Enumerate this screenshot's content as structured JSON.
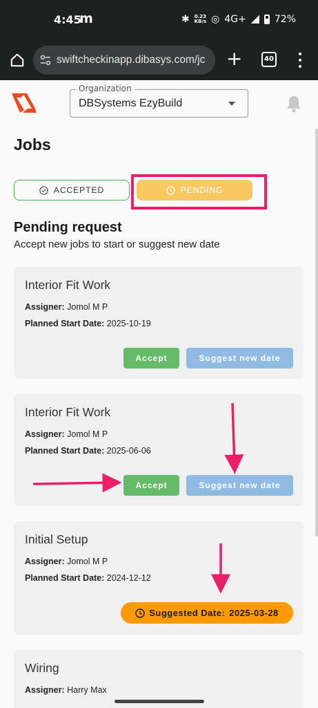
{
  "status": {
    "time": "4:45",
    "app_glyph": "m",
    "speed_value": "0.23",
    "speed_unit": "KB/s",
    "network": "4G+",
    "battery": "72%"
  },
  "browser": {
    "url": "swiftcheckinapp.dibasys.com/jc",
    "tab_count": "40"
  },
  "header": {
    "org_label": "Organization",
    "org_value": "DBSystems EzyBuild"
  },
  "page": {
    "title": "Jobs",
    "tabs": [
      {
        "label": "ACCEPTED"
      },
      {
        "label": "PENDING"
      }
    ],
    "section_title": "Pending request",
    "section_subtitle": "Accept new jobs to start or suggest new date"
  },
  "labels": {
    "assigner": "Assigner:",
    "planned": "Planned Start Date:",
    "accept": "Accept",
    "suggest": "Suggest new date",
    "suggested_prefix": "Suggested Date:"
  },
  "jobs": [
    {
      "title": "Interior Fit Work",
      "assigner": "Jomol M P",
      "planned_start": "2025-10-19"
    },
    {
      "title": "Interior Fit Work",
      "assigner": "Jomol M P",
      "planned_start": "2025-06-06"
    },
    {
      "title": "Initial Setup",
      "assigner": "Jomol M P",
      "planned_start": "2024-12-12",
      "suggested_date": "2025-03-28"
    },
    {
      "title": "Wiring",
      "assigner": "Harry Max"
    }
  ],
  "colors": {
    "accent_pending": "#f8c861",
    "accepted_border": "#4caf50",
    "accept_button": "#66bb6a",
    "suggest_button": "#90bbe3",
    "suggested_badge": "#ff9a00",
    "annotation": "#ee1d68"
  }
}
